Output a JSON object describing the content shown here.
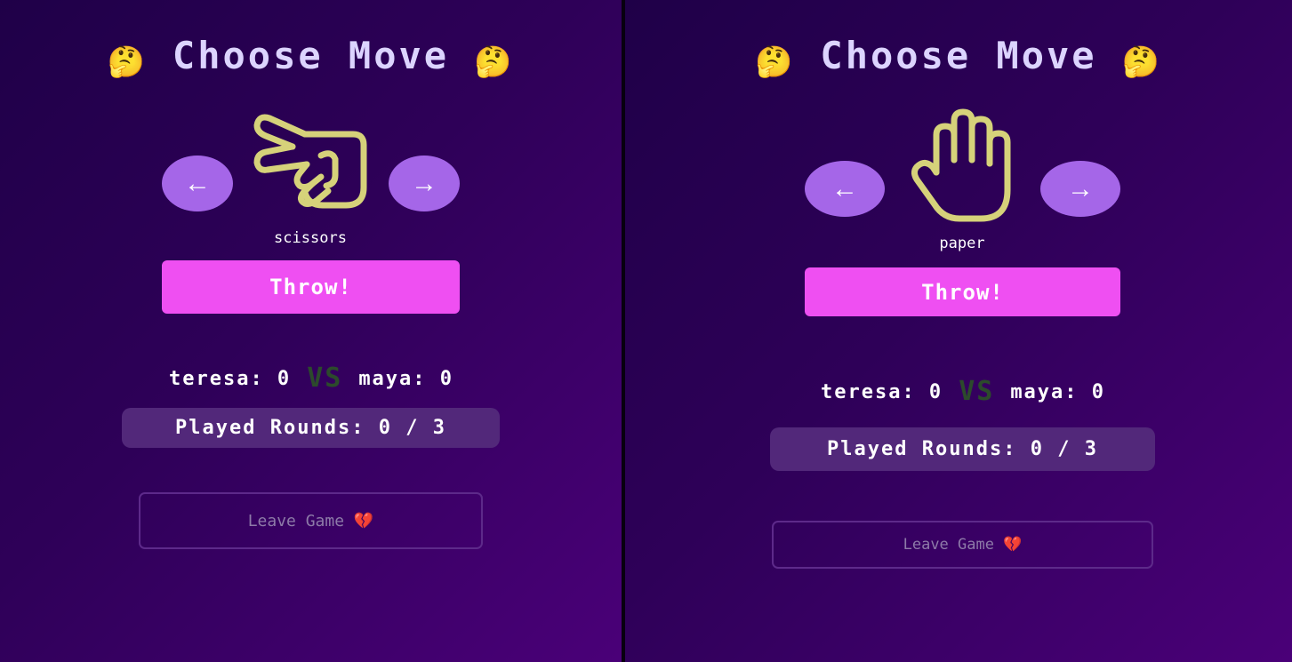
{
  "left": {
    "title": "Choose Move",
    "title_emoji": "🤔",
    "prev_arrow": "←",
    "next_arrow": "→",
    "move_label": "scissors",
    "throw_label": "Throw!",
    "player1_score": "teresa: 0",
    "vs_label": "VS",
    "player2_score": "maya: 0",
    "rounds_label": "Played Rounds: 0 / 3",
    "leave_label": "Leave Game 💔"
  },
  "right": {
    "title": "Choose Move",
    "title_emoji": "🤔",
    "prev_arrow": "←",
    "next_arrow": "→",
    "move_label": "paper",
    "throw_label": "Throw!",
    "player1_score": "teresa: 0",
    "vs_label": "VS",
    "player2_score": "maya: 0",
    "rounds_label": "Played Rounds: 0 / 3",
    "leave_label": "Leave Game 💔"
  },
  "colors": {
    "background_start": "#1f0048",
    "background_end": "#4a0078",
    "nav_button": "#a566e8",
    "throw_button": "#ef4ff2",
    "hand_outline": "#d6d27a",
    "rounds_badge": "#52287a",
    "vs_text": "#2c4a2c"
  },
  "icons": {
    "left_hand": "scissors-hand-icon",
    "right_hand": "paper-hand-icon"
  }
}
